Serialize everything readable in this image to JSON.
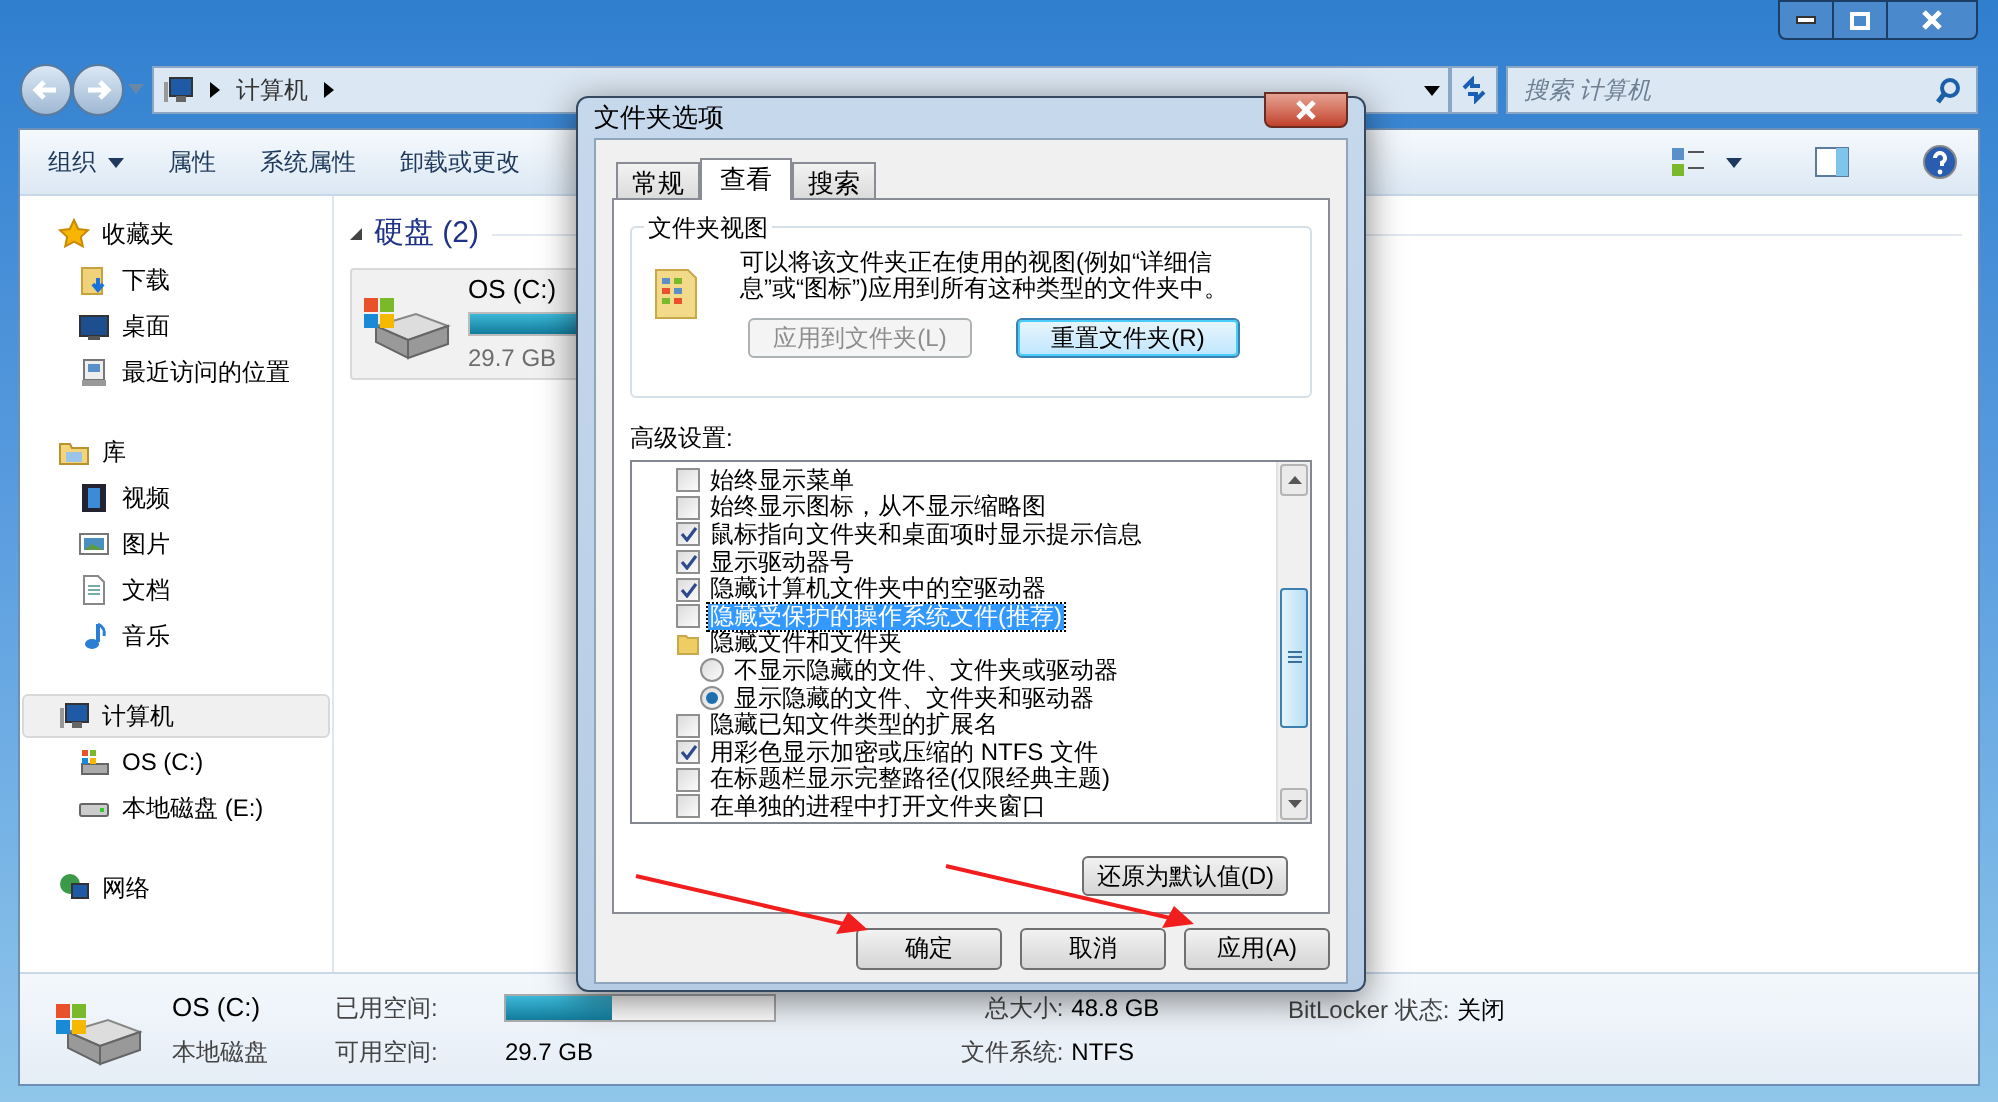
{
  "address_bar": {
    "path": [
      "计算机"
    ],
    "search_placeholder": "搜索 计算机"
  },
  "toolbar": {
    "buttons": [
      {
        "label": "组织",
        "dropdown": true
      },
      {
        "label": "属性",
        "dropdown": false
      },
      {
        "label": "系统属性",
        "dropdown": false
      },
      {
        "label": "卸载或更改",
        "dropdown": false
      }
    ]
  },
  "sidebar": {
    "items": [
      {
        "label": "收藏夹",
        "selected": false,
        "children": [
          {
            "label": "下载",
            "selected": false
          },
          {
            "label": "桌面",
            "selected": false
          },
          {
            "label": "最近访问的位置",
            "selected": false
          }
        ]
      },
      {
        "label": "库",
        "selected": false,
        "children": [
          {
            "label": "视频",
            "selected": false
          },
          {
            "label": "图片",
            "selected": false
          },
          {
            "label": "文档",
            "selected": false
          },
          {
            "label": "音乐",
            "selected": false
          }
        ]
      },
      {
        "label": "计算机",
        "selected": true,
        "children": [
          {
            "label": "OS (C:)",
            "selected": false
          },
          {
            "label": "本地磁盘 (E:)",
            "selected": false
          }
        ]
      },
      {
        "label": "网络",
        "selected": false
      }
    ]
  },
  "content": {
    "group_title": "硬盘 (2)",
    "drives": [
      {
        "name": "OS (C:)",
        "level": 0.39,
        "free": "29.7 GB",
        "selected": true
      }
    ]
  },
  "details_pane": {
    "name": "OS (C:)",
    "type": "本地磁盘",
    "used_label": "已用空间:",
    "level": 0.39,
    "free_label": "可用空间:",
    "free": "29.7 GB",
    "total_label": "总大小:",
    "total": "48.8 GB",
    "fs_label": "文件系统:",
    "fs": "NTFS",
    "bitlocker_label": "BitLocker 状态:",
    "bitlocker": "关闭"
  },
  "dialog": {
    "title": "文件夹选项",
    "tabs": [
      {
        "label": "常规",
        "selected": false
      },
      {
        "label": "查看",
        "selected": true
      },
      {
        "label": "搜索",
        "selected": false
      }
    ],
    "folder_views": {
      "title": "文件夹视图",
      "description": "可以将该文件夹正在使用的视图(例如“详细信息”或“图标”)应用到所有这种类型的文件夹中。",
      "buttons": [
        {
          "label": "应用到文件夹(L)",
          "disabled": true
        },
        {
          "label": "重置文件夹(R)",
          "disabled": false
        }
      ]
    },
    "advanced_label": "高级设置:",
    "settings": [
      {
        "kind": "checkbox",
        "label": "始终显示菜单",
        "checked": false,
        "selected": false
      },
      {
        "kind": "checkbox",
        "label": "始终显示图标，从不显示缩略图",
        "checked": false,
        "selected": false
      },
      {
        "kind": "checkbox",
        "label": "鼠标指向文件夹和桌面项时显示提示信息",
        "checked": true,
        "selected": false
      },
      {
        "kind": "checkbox",
        "label": "显示驱动器号",
        "checked": true,
        "selected": false
      },
      {
        "kind": "checkbox",
        "label": "隐藏计算机文件夹中的空驱动器",
        "checked": true,
        "selected": false
      },
      {
        "kind": "checkbox",
        "label": "隐藏受保护的操作系统文件(推荐)",
        "checked": false,
        "selected": true
      },
      {
        "kind": "folder",
        "label": "隐藏文件和文件夹",
        "selected": false
      },
      {
        "kind": "radio",
        "label": "不显示隐藏的文件、文件夹或驱动器",
        "checked": false,
        "selected": false
      },
      {
        "kind": "radio",
        "label": "显示隐藏的文件、文件夹和驱动器",
        "checked": true,
        "selected": false
      },
      {
        "kind": "checkbox",
        "label": "隐藏已知文件类型的扩展名",
        "checked": false,
        "selected": false
      },
      {
        "kind": "checkbox",
        "label": "用彩色显示加密或压缩的 NTFS 文件",
        "checked": true,
        "selected": false
      },
      {
        "kind": "checkbox",
        "label": "在标题栏显示完整路径(仅限经典主题)",
        "checked": false,
        "selected": false
      },
      {
        "kind": "checkbox",
        "label": "在单独的进程中打开文件夹窗口",
        "checked": false,
        "selected": false
      }
    ],
    "restore_button": "还原为默认值(D)",
    "buttons": [
      {
        "label": "确定"
      },
      {
        "label": "取消"
      },
      {
        "label": "应用(A)"
      }
    ]
  }
}
